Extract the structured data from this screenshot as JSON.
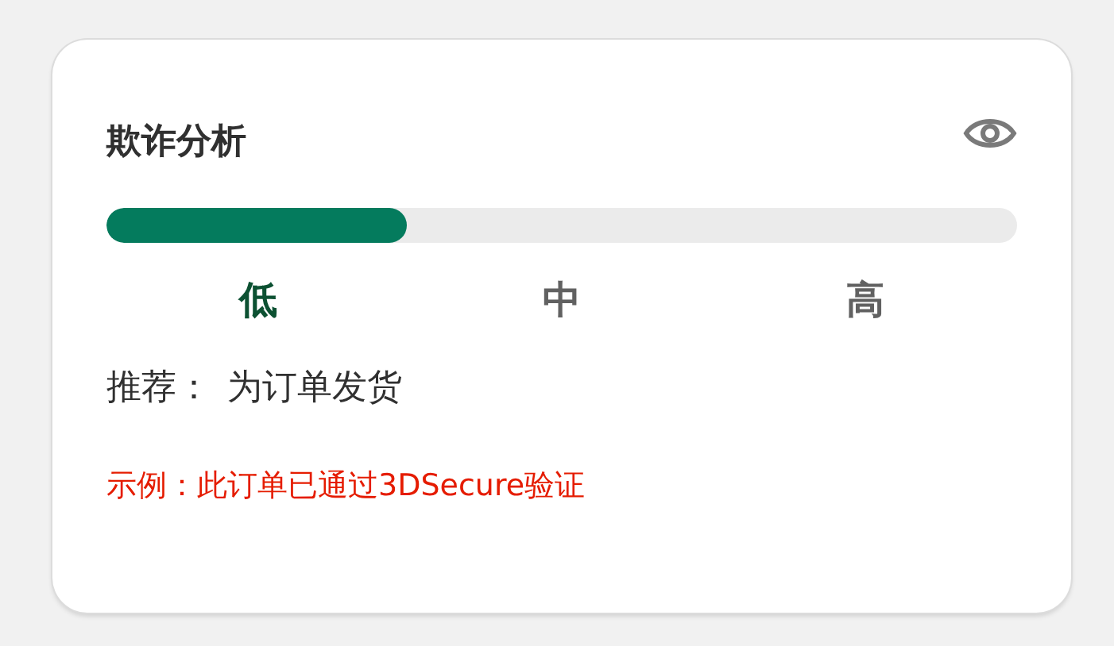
{
  "card": {
    "title": "欺诈分析",
    "risk": {
      "level": 0.33,
      "levels": [
        {
          "label": "低",
          "selected": true
        },
        {
          "label": "中",
          "selected": false
        },
        {
          "label": "高",
          "selected": false
        }
      ]
    },
    "recommendation": {
      "label": "推荐：",
      "value": "为订单发货"
    },
    "note": "示例：此订单已通过3DSecure验证"
  }
}
